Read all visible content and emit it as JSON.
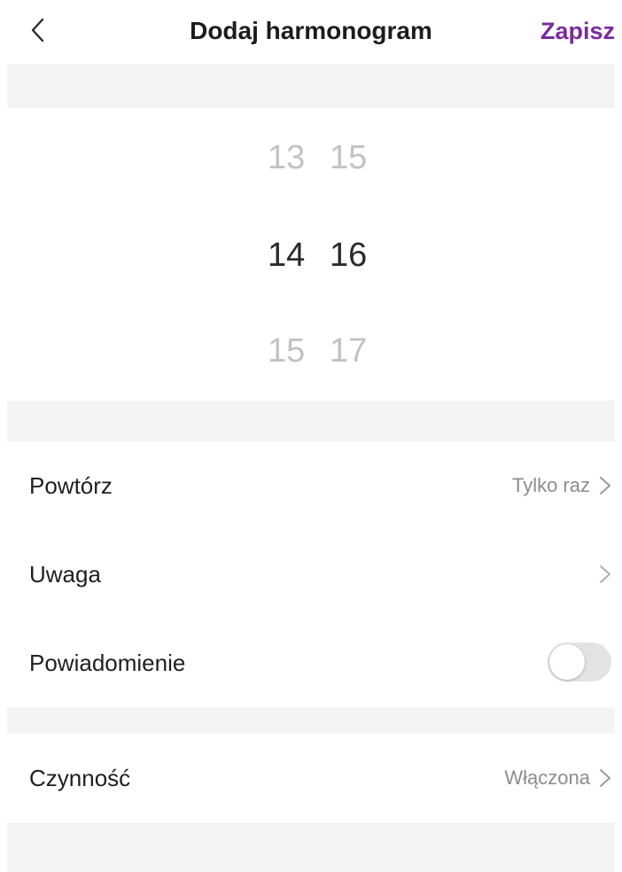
{
  "header": {
    "title": "Dodaj harmonogram",
    "save_label": "Zapisz",
    "back_icon": "chevron-left-icon",
    "accent_color": "#7a2b9e"
  },
  "time_picker": {
    "hours": {
      "prev": "13",
      "selected": "14",
      "next": "15"
    },
    "minutes": {
      "prev": "15",
      "selected": "16",
      "next": "17"
    }
  },
  "settings": {
    "repeat": {
      "label": "Powtórz",
      "value": "Tylko raz"
    },
    "note": {
      "label": "Uwaga",
      "value": ""
    },
    "notification": {
      "label": "Powiadomienie",
      "enabled": false
    },
    "action": {
      "label": "Czynność",
      "value": "Włączona"
    }
  }
}
